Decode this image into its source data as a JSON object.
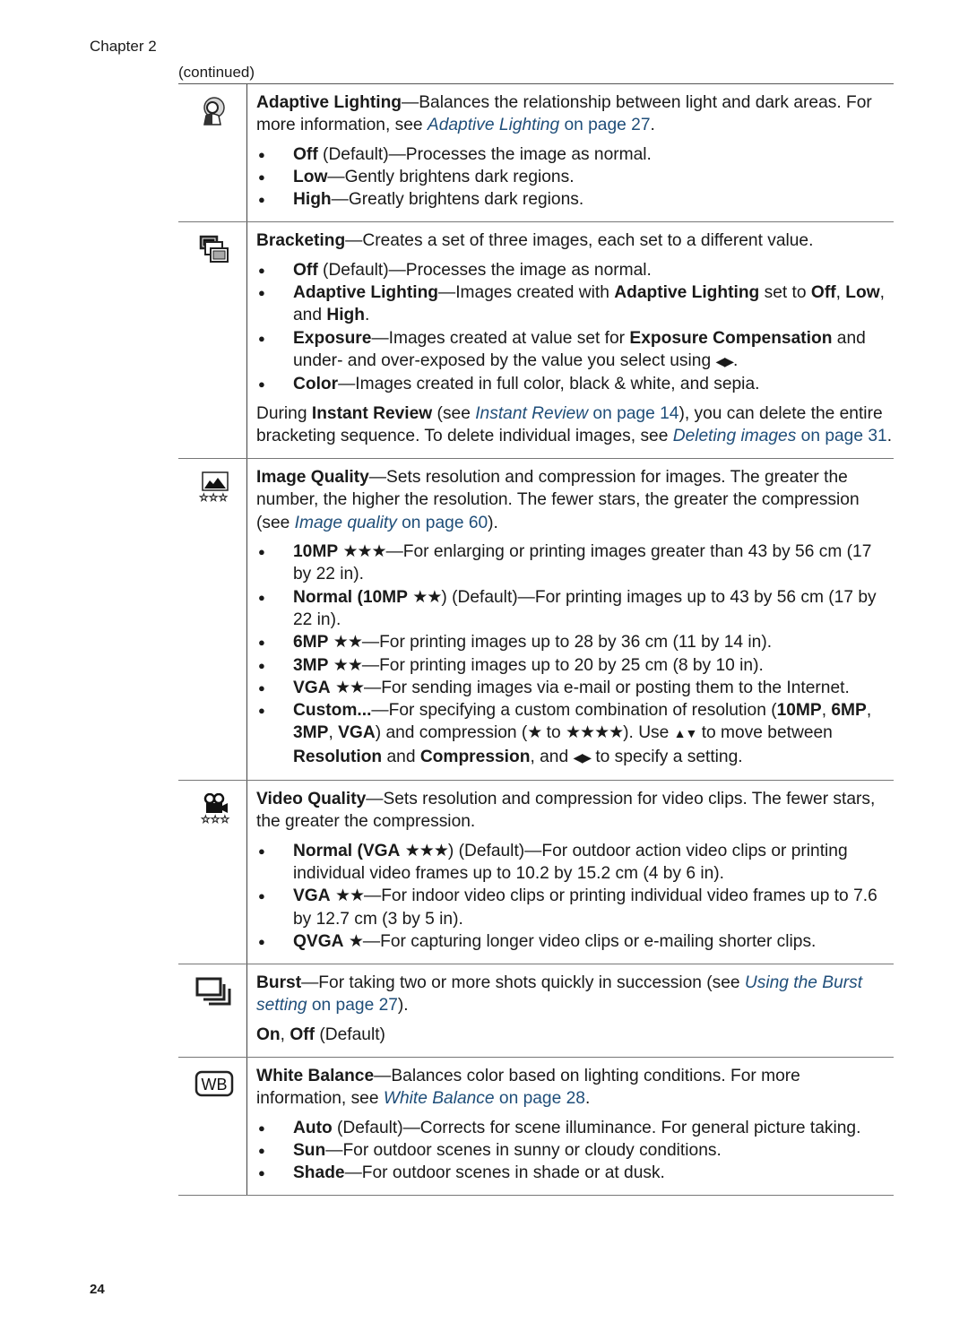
{
  "header": {
    "chapter": "Chapter 2",
    "continued": "(continued)"
  },
  "link_color": "#1f4e79",
  "rows": [
    {
      "icon": "adaptive-lighting-icon",
      "title": "Adaptive Lighting",
      "desc": "—Balances the relationship between light and dark areas. For more information, see ",
      "link_text": "Adaptive Lighting",
      "link_page": " on page 27",
      "desc_end": ".",
      "items": [
        {
          "term": "Off",
          "text": " (Default)—Processes the image as normal."
        },
        {
          "term": "Low",
          "text": "—Gently brightens dark regions."
        },
        {
          "term": "High",
          "text": "—Greatly brightens dark regions."
        }
      ]
    },
    {
      "icon": "bracketing-icon",
      "title": "Bracketing",
      "desc": "—Creates a set of three images, each set to a different value.",
      "items": [
        {
          "term": "Off",
          "text": " (Default)—Processes the image as normal."
        },
        {
          "term": "Adaptive Lighting",
          "text": "—Images created with ",
          "term2": "Adaptive Lighting",
          "text2": " set to ",
          "term3": "Off",
          "text3": ", ",
          "term4": "Low",
          "text4": ", and ",
          "term5": "High",
          "text5": "."
        },
        {
          "term": "Exposure",
          "text": "—Images created at value set for ",
          "term2": "Exposure Compensation",
          "text2": " and under- and over-exposed by the value you select using ",
          "arrows": "◀▶",
          "text3": "."
        },
        {
          "term": "Color",
          "text": "—Images created in full color, black & white, and sepia."
        }
      ],
      "note": {
        "pre": "During ",
        "term": "Instant Review",
        "mid": " (see ",
        "link1_text": "Instant Review",
        "link1_page": " on page 14",
        "mid2": "), you can delete the entire bracketing sequence. To delete individual images, see ",
        "link2_text": "Deleting images",
        "link2_page": " on page 31",
        "end": "."
      }
    },
    {
      "icon": "image-quality-icon",
      "title": "Image Quality",
      "desc": "—Sets resolution and compression for images. The greater the number, the higher the resolution. The fewer stars, the greater the compression (see ",
      "link_text": "Image quality",
      "link_page": " on page 60",
      "desc_end": ").",
      "items": [
        {
          "term": "10MP",
          "stars": "★★★",
          "text": "—For enlarging or printing images greater than 43 by 56 cm (17 by 22 in)."
        },
        {
          "term": "Normal (10MP",
          "stars": "★★",
          "text": ") (Default)—For printing images up to 43 by 56 cm (17 by 22 in)."
        },
        {
          "term": "6MP",
          "stars": "★★",
          "text": "—For printing images up to 28 by 36 cm (11 by 14 in)."
        },
        {
          "term": "3MP",
          "stars": "★★",
          "text": "—For printing images up to 20 by 25 cm (8 by 10 in)."
        },
        {
          "term": "VGA",
          "stars": "★★",
          "text": "—For sending images via e-mail or posting them to the Internet."
        },
        {
          "term": "Custom...",
          "text": "—For specifying a custom combination of resolution (",
          "r1": "10MP",
          "s1": ", ",
          "r2": "6MP",
          "s2": ", ",
          "r3": "3MP",
          "s3": ", ",
          "r4": "VGA",
          "s4": ") and compression (",
          "star_min": "★",
          "s5": " to ",
          "star_max": "★★★★",
          "s6": "). Use ",
          "updown": "▲▼",
          "s7": " to move between ",
          "t1": "Resolution",
          "s8": " and ",
          "t2": "Compression",
          "s9": ", and ",
          "leftright": "◀▶",
          "s10": " to specify a setting."
        }
      ]
    },
    {
      "icon": "video-quality-icon",
      "title": "Video Quality",
      "desc": "—Sets resolution and compression for video clips. The fewer stars, the greater the compression.",
      "items": [
        {
          "term": "Normal (VGA",
          "stars": "★★★",
          "text": ") (Default)—For outdoor action video clips or printing individual video frames up to 10.2 by 15.2 cm (4 by 6 in)."
        },
        {
          "term": "VGA",
          "stars": "★★",
          "text": "—For indoor video clips or printing individual video frames up to 7.6 by 12.7 cm (3 by 5 in)."
        },
        {
          "term": "QVGA",
          "stars": "★",
          "text": "—For capturing longer video clips or e-mailing shorter clips."
        }
      ]
    },
    {
      "icon": "burst-icon",
      "title": "Burst",
      "desc": "—For taking two or more shots quickly in succession (see ",
      "link_text": "Using the Burst setting",
      "link_page": " on page 27",
      "desc_end": ").",
      "options": {
        "on": "On",
        "sep": ", ",
        "off": "Off",
        "default": " (Default)"
      }
    },
    {
      "icon": "white-balance-icon",
      "icon_label": "WB",
      "title": "White Balance",
      "desc": "—Balances color based on lighting conditions. For more information, see ",
      "link_text": "White Balance",
      "link_page": " on page 28",
      "desc_end": ".",
      "items": [
        {
          "term": "Auto",
          "text": " (Default)—Corrects for scene illuminance. For general picture taking."
        },
        {
          "term": "Sun",
          "text": "—For outdoor scenes in sunny or cloudy conditions."
        },
        {
          "term": "Shade",
          "text": "—For outdoor scenes in shade or at dusk."
        }
      ]
    }
  ],
  "footer": {
    "page_number": "24"
  }
}
